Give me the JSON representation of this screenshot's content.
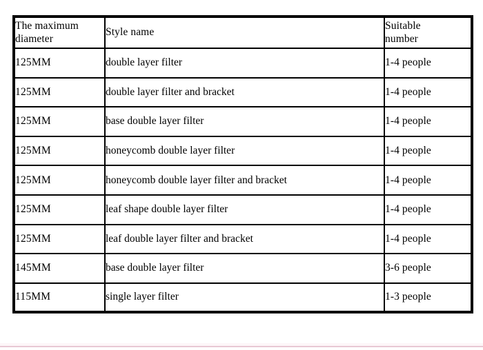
{
  "page": {
    "background_color": "#ffffff",
    "text_color": "#000000",
    "border_color": "#000000",
    "accent_rule_color": "#e8c8d4"
  },
  "table": {
    "columns": [
      {
        "key": "diameter",
        "header_lines": [
          "The maximum",
          "diameter"
        ],
        "header_text": "The maximum diameter"
      },
      {
        "key": "style",
        "header_lines": [
          "Style name"
        ],
        "header_text": "Style name"
      },
      {
        "key": "number",
        "header_lines": [
          "Suitable",
          "number"
        ],
        "header_text": "Suitable number"
      }
    ],
    "rows": [
      {
        "diameter": "125MM",
        "style": "double layer filter",
        "number": "1-4 people"
      },
      {
        "diameter": "125MM",
        "style": "double layer filter and bracket",
        "number": "1-4 people"
      },
      {
        "diameter": "125MM",
        "style": "base double layer filter",
        "number": "1-4 people"
      },
      {
        "diameter": "125MM",
        "style": "honeycomb double layer filter",
        "number": "1-4 people"
      },
      {
        "diameter": "125MM",
        "style": "honeycomb double layer filter and bracket",
        "number": "1-4 people"
      },
      {
        "diameter": "125MM",
        "style": "leaf shape double layer filter",
        "number": "1-4 people"
      },
      {
        "diameter": "125MM",
        "style": "leaf double layer filter and bracket",
        "number": "1-4 people"
      },
      {
        "diameter": "145MM",
        "style": "base double layer filter",
        "number": "3-6 people"
      },
      {
        "diameter": "115MM",
        "style": "single layer filter",
        "number": "1-3 people"
      }
    ]
  }
}
